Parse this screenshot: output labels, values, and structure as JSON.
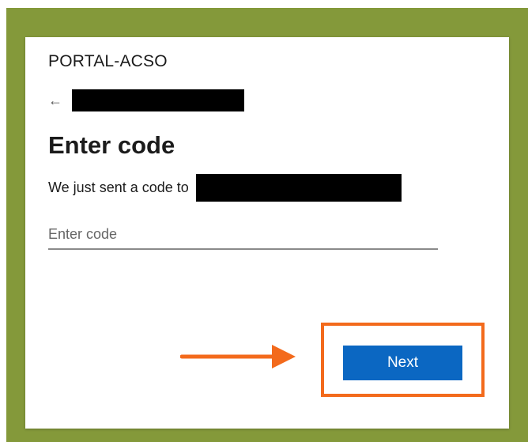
{
  "organization": {
    "name": "PORTAL-ACSO"
  },
  "identity": {
    "back_icon": "back-arrow-icon",
    "account_redacted": true
  },
  "form": {
    "heading": "Enter code",
    "sent_message": "We just sent a code to",
    "destination_redacted": true,
    "code_input": {
      "placeholder": "Enter code",
      "value": ""
    },
    "next_label": "Next"
  },
  "annotation": {
    "highlight_color": "#f36a1c",
    "frame_color": "#84993a"
  },
  "colors": {
    "primary_button": "#0b67c2",
    "text": "#1b1b1b"
  }
}
